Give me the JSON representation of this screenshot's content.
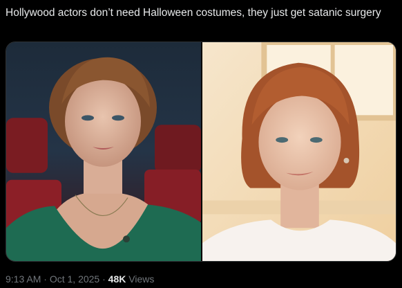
{
  "tweet": {
    "text": "Hollywood actors don’t need Halloween costumes, they just get satanic surgery"
  },
  "media": {
    "left_photo_icon": "photo-woman-cinema",
    "right_photo_icon": "photo-woman-window"
  },
  "meta": {
    "time": "9:13 AM",
    "separator": "·",
    "date": "Oct 1, 2025",
    "views_count": "48K",
    "views_label": "Views"
  },
  "colors": {
    "background": "#000000",
    "text_primary": "#e7e9ea",
    "text_secondary": "#71767b",
    "border": "#2f3336"
  }
}
